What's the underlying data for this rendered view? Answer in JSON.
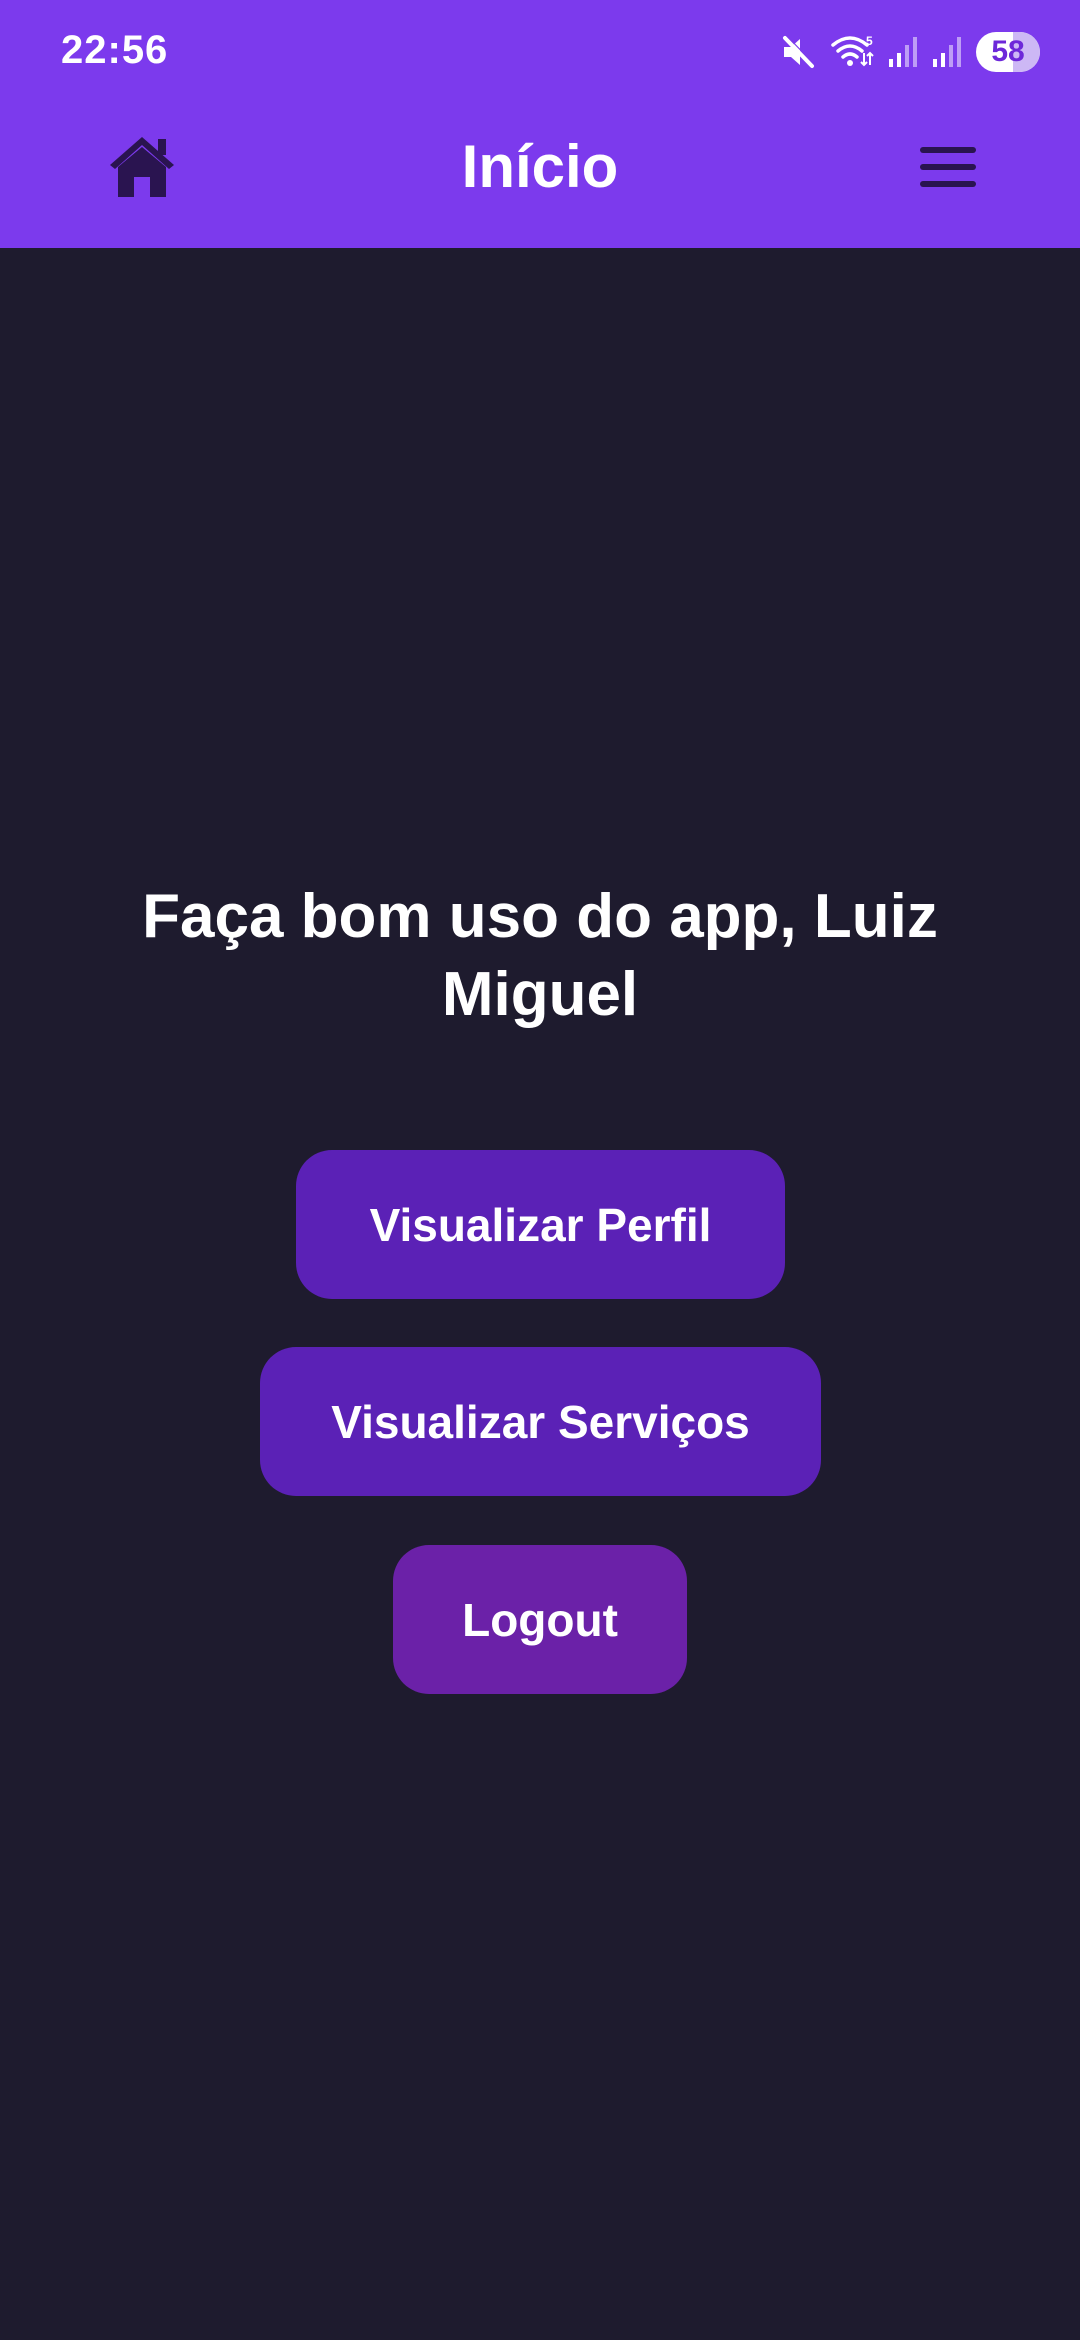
{
  "status_bar": {
    "time": "22:56",
    "battery_level": "58",
    "battery_fraction": 0.58,
    "icons": [
      "mute-icon",
      "wifi-icon",
      "signal-icon",
      "signal-icon",
      "battery-icon"
    ]
  },
  "header": {
    "title": "Início",
    "left_icon": "home-icon",
    "right_icon": "menu-icon"
  },
  "main": {
    "greeting": "Faça bom uso do app, Luiz Miguel",
    "buttons": {
      "profile": "Visualizar Perfil",
      "services": "Visualizar Serviços",
      "logout": "Logout"
    }
  },
  "colors": {
    "header_bg": "#7c3aed",
    "page_bg": "#1e1b2e",
    "primary_button": "#5b21b6",
    "logout_button": "#6b21a8",
    "icon_dark": "#2a1450",
    "text": "#ffffff"
  }
}
